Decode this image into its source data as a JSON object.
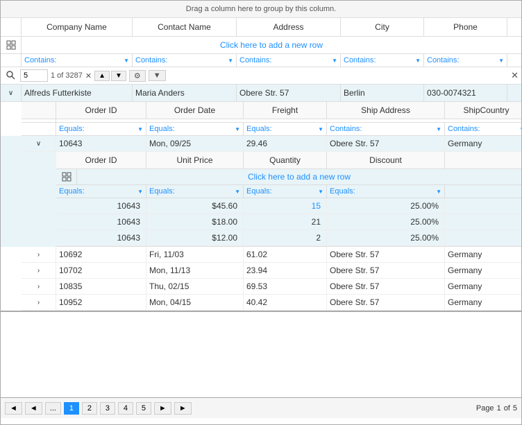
{
  "header": {
    "drag_hint": "Drag a column here to group by this column."
  },
  "columns": {
    "main": [
      "Company Name",
      "Contact Name",
      "Address",
      "City",
      "Phone"
    ],
    "orders": [
      "Order ID",
      "Order Date",
      "Freight",
      "Ship Address",
      "ShipCountry"
    ],
    "order_details": [
      "Order ID",
      "Unit Price",
      "Quantity",
      "Discount"
    ]
  },
  "filters": {
    "main": [
      "Contains:",
      "Contains:",
      "Contains:",
      "Contains:",
      "Contains:"
    ],
    "orders": [
      "Equals:",
      "Equals:",
      "Equals:",
      "Contains:",
      "Contains:"
    ],
    "order_details": [
      "Equals:",
      "Equals:",
      "Equals:",
      "Equals:"
    ]
  },
  "search": {
    "value": "5",
    "count": "1 of 3287",
    "clear_label": "✕",
    "close_label": "✕"
  },
  "add_row_label": "Click here to add a new row",
  "master_row": {
    "company": "Alfreds Futterkiste",
    "contact": "Maria Anders",
    "address": "Obere Str. 57",
    "city": "Berlin",
    "phone": "030-0074321"
  },
  "order_row": {
    "order_id": "10643",
    "order_date": "Mon, 09/25",
    "freight": "29.46",
    "ship_address": "Obere Str. 57",
    "ship_country": "Germany"
  },
  "order_detail_rows": [
    {
      "order_id": "10643",
      "unit_price": "$45.60",
      "quantity": "15",
      "discount": "25.00%"
    },
    {
      "order_id": "10643",
      "unit_price": "$18.00",
      "quantity": "21",
      "discount": "25.00%"
    },
    {
      "order_id": "10643",
      "unit_price": "$12.00",
      "quantity": "2",
      "discount": "25.00%"
    }
  ],
  "collapsed_orders": [
    {
      "order_id": "10692",
      "order_date": "Fri, 11/03",
      "freight": "61.02",
      "ship_address": "Obere Str. 57",
      "ship_country": "Germany"
    },
    {
      "order_id": "10702",
      "order_date": "Mon, 11/13",
      "freight": "23.94",
      "ship_address": "Obere Str. 57",
      "ship_country": "Germany"
    },
    {
      "order_id": "10835",
      "order_date": "Thu, 02/15",
      "freight": "69.53",
      "ship_address": "Obere Str. 57",
      "ship_country": "Germany"
    },
    {
      "order_id": "10952",
      "order_date": "Mon, 04/15",
      "freight": "40.42",
      "ship_address": "Obere Str. 57",
      "ship_country": "Germany"
    }
  ],
  "pagination": {
    "prev_prev": "◄",
    "prev": "◄",
    "ellipsis": "...",
    "pages": [
      "1",
      "2",
      "3",
      "4",
      "5"
    ],
    "next": "►",
    "next_next": "►",
    "page_label": "Page",
    "current_page": "1",
    "total_pages": "5",
    "of_label": "of"
  }
}
